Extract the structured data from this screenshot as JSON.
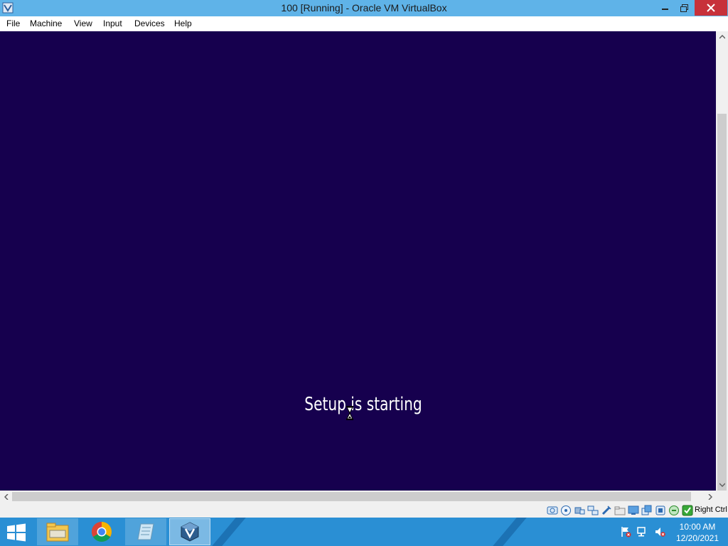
{
  "window": {
    "title": "100 [Running] - Oracle VM VirtualBox"
  },
  "menubar": {
    "items": [
      "File",
      "Machine",
      "View",
      "Input",
      "Devices",
      "Help"
    ]
  },
  "guest": {
    "message": "Setup is starting",
    "background_color": "#16004e"
  },
  "statusbar": {
    "icons": [
      "hard-disk-icon",
      "optical-drive-icon",
      "audio-icon",
      "network-icon",
      "usb-icon",
      "shared-folders-icon",
      "display-icon",
      "video-capture-icon",
      "cpu-icon",
      "mouse-integration-icon",
      "keyboard-icon"
    ],
    "host_key": "Right Ctrl"
  },
  "taskbar": {
    "apps": [
      "file-explorer-icon",
      "chrome-icon",
      "notepad-icon",
      "virtualbox-icon"
    ],
    "tray_icons": [
      "action-center-flag-icon",
      "network-icon",
      "volume-muted-icon"
    ],
    "time": "10:00 AM",
    "date": "12/20/2021"
  },
  "colors": {
    "titlebar": "#5fb3e8",
    "close_button": "#c7313a",
    "taskbar": "#2a8fd4"
  }
}
